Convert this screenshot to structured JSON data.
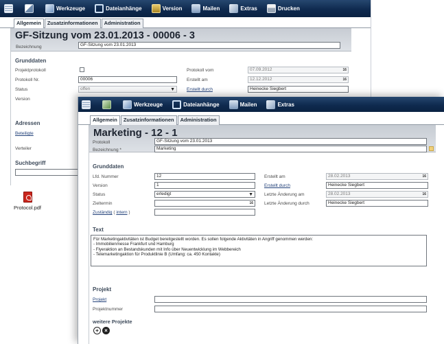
{
  "back": {
    "toolbar": {
      "tools": "Werkzeuge",
      "attachments": "Dateianhänge",
      "version": "Version",
      "mail": "Mailen",
      "extras": "Extras",
      "print": "Drucken"
    },
    "tabs": [
      "Allgemein",
      "Zusatzinformationen",
      "Administration"
    ],
    "title": "GF-Sitzung vom 23.01.2013 - 00006 - 3",
    "bezeichnung_label": "Bezeichnung",
    "bezeichnung_value": "GF-Sitzung vom 23.01.2013",
    "grunddaten": "Grunddaten",
    "fields": {
      "protokollprotokoll": "Projektprotokoll",
      "protokoll_nr": "Protokoll Nr.",
      "protokoll_nr_value": "00006",
      "status": "Status",
      "status_value": "offen",
      "version": "Version",
      "protokoll_vom": "Protokoll vom",
      "protokoll_vom_value": "07.09.2012",
      "erstellt_am": "Erstellt am",
      "erstellt_am_value": "12.12.2012",
      "erstellt_durch": "Erstellt durch",
      "erstellt_durch_value": "Heinecke Siegbert",
      "date_badge": "16"
    },
    "adressen": "Adressen",
    "beteiligte": "Beteiligte",
    "verteiler": "Verteiler",
    "suchbegriff": "Suchbegriff",
    "file_name": "Protocol.pdf"
  },
  "front": {
    "toolbar": {
      "tools": "Werkzeuge",
      "attachments": "Dateianhänge",
      "mail": "Mailen",
      "extras": "Extras"
    },
    "tabs": [
      "Allgemein",
      "Zusatzinformationen",
      "Administration"
    ],
    "title": "Marketing - 12 - 1",
    "protokoll_label": "Protokoll",
    "protokoll_value": "GF-Sitzung vom 23.01.2013",
    "bezeichnung_label": "Bezeichnung *",
    "bezeichnung_value": "Marketing",
    "grunddaten": "Grunddaten",
    "fields": {
      "lfd_nummer": "Lfd. Nummer",
      "lfd_nummer_value": "12",
      "version": "Version",
      "version_value": "1",
      "status": "Status",
      "status_value": "erledigt",
      "zieltermin": "Zieltermin",
      "zustaendig": "Zuständig",
      "intern": "intern",
      "erstellt_am": "Erstellt am",
      "erstellt_am_value": "28.02.2013",
      "erstellt_durch": "Erstellt durch",
      "erstellt_durch_value": "Heinecke Siegbert",
      "letzte_aenderung_am": "Letzte Änderung am",
      "letzte_aenderung_am_value": "28.02.2013",
      "letzte_aenderung_durch": "Letzte Änderung durch",
      "letzte_aenderung_durch_value": "Heinecke Siegbert",
      "date_badge": "16"
    },
    "text_label": "Text",
    "text_lines": [
      "Für Marketingaktivitäten ist Budget bereitgestellt worden. Es sollen folgende Aktivitäten in Angriff genommen werden:",
      "- Immobilienmesse Frankfurt und Hamburg",
      "- Flyeraktion an Bestandskunden mit Info über Neuentwicklung im Webbereich",
      "- Telemarketingaktion für Produktlinie B (Umfang: ca. 450 Kontakte)"
    ],
    "projekt_section": "Projekt",
    "projekt_label": "Projekt",
    "projektnummer_label": "Projektnummer",
    "weitere_projekte": "weitere Projekte"
  }
}
